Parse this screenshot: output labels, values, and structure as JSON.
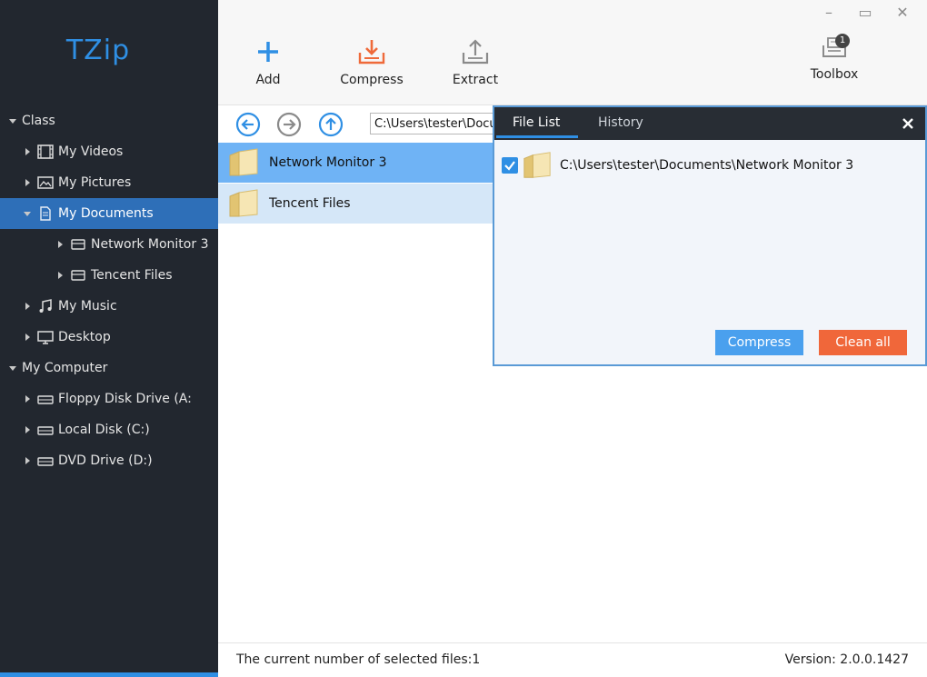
{
  "app": {
    "title": "TZip"
  },
  "window": {
    "minimize": "–",
    "maximize": "▭",
    "close": "✕"
  },
  "toolbar": {
    "add_label": "Add",
    "compress_label": "Compress",
    "extract_label": "Extract",
    "toolbox_label": "Toolbox",
    "toolbox_badge": "1"
  },
  "sidebar": {
    "class_label": "Class",
    "class_items": [
      {
        "label": "My Videos"
      },
      {
        "label": "My Pictures"
      },
      {
        "label": "My Documents"
      },
      {
        "label": "Network Monitor 3"
      },
      {
        "label": "Tencent Files"
      },
      {
        "label": "My Music"
      },
      {
        "label": "Desktop"
      }
    ],
    "computer_label": "My Computer",
    "computer_items": [
      {
        "label": "Floppy Disk Drive (A:"
      },
      {
        "label": "Local Disk (C:)"
      },
      {
        "label": "DVD Drive (D:)"
      }
    ]
  },
  "nav": {
    "path": "C:\\Users\\tester\\Documents"
  },
  "files": [
    {
      "name": "Network Monitor 3"
    },
    {
      "name": "Tencent Files"
    }
  ],
  "panel": {
    "tabs": [
      {
        "label": "File List"
      },
      {
        "label": "History"
      }
    ],
    "close": "✕",
    "items": [
      {
        "path": "C:\\Users\\tester\\Documents\\Network Monitor 3"
      }
    ],
    "compress_button": "Compress",
    "clear_button": "Clean all"
  },
  "status": {
    "selected": "The current number of selected files:1",
    "version": "Version: 2.0.0.1427"
  },
  "colors": {
    "accent": "#2f8fe4",
    "sidebar_bg": "#22272f",
    "selected_row": "#6fb3f5",
    "clear_button": "#f0673a"
  }
}
